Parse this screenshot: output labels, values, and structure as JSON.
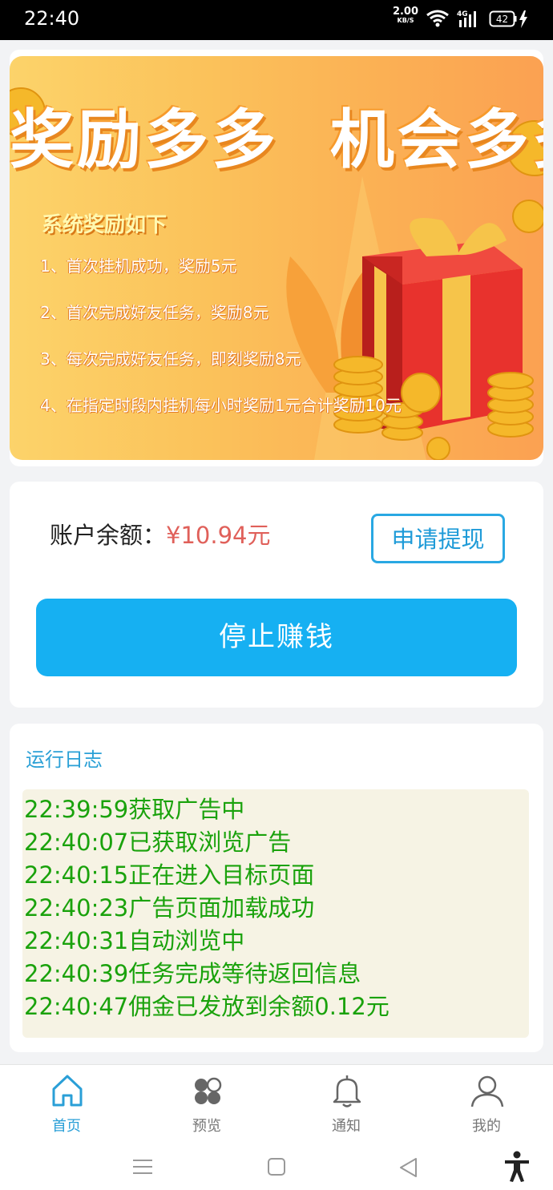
{
  "status_bar": {
    "time": "22:40",
    "net_speed_value": "2.00",
    "net_speed_unit": "KB/S",
    "network_type": "4G",
    "battery_level": "42",
    "icons": [
      "wifi-icon",
      "signal-icon",
      "battery-icon",
      "charging-icon"
    ]
  },
  "banner": {
    "title": "奖励多多  机会多多",
    "subtitle": "系统奖励如下",
    "rules": [
      "1、首次挂机成功，奖励5元",
      "2、首次完成好友任务，奖励8元",
      "3、每次完成好友任务，即刻奖励8元",
      "4、在指定时段内挂机每小时奖励1元合计奖励10元"
    ],
    "colors": {
      "background": "#fbc35b",
      "gift_box": "#e8322d",
      "ribbon": "#f6c44a"
    }
  },
  "account": {
    "balance_label": "账户余额：",
    "balance_value": "¥10.94元",
    "withdraw_button": "申请提现",
    "stop_button": "停止赚钱"
  },
  "log": {
    "title": "运行日志",
    "entries": [
      "22:39:59获取广告中",
      "22:40:07已获取浏览广告",
      "22:40:15正在进入目标页面",
      "22:40:23广告页面加载成功",
      "22:40:31自动浏览中",
      "22:40:39任务完成等待返回信息",
      "22:40:47佣金已发放到余额0.12元"
    ]
  },
  "tabbar": {
    "active_index": 0,
    "tabs": [
      {
        "label": "首页",
        "icon": "home-icon"
      },
      {
        "label": "预览",
        "icon": "apps-icon"
      },
      {
        "label": "通知",
        "icon": "bell-icon"
      },
      {
        "label": "我的",
        "icon": "user-icon"
      }
    ]
  },
  "system_nav": {
    "icons": [
      "menu-icon",
      "home-square-icon",
      "back-icon",
      "accessibility-icon"
    ]
  },
  "colors": {
    "accent": "#16b0f2",
    "balance": "#e0605a",
    "log_text": "#1aa20c",
    "active_tab": "#2a9fd7"
  }
}
